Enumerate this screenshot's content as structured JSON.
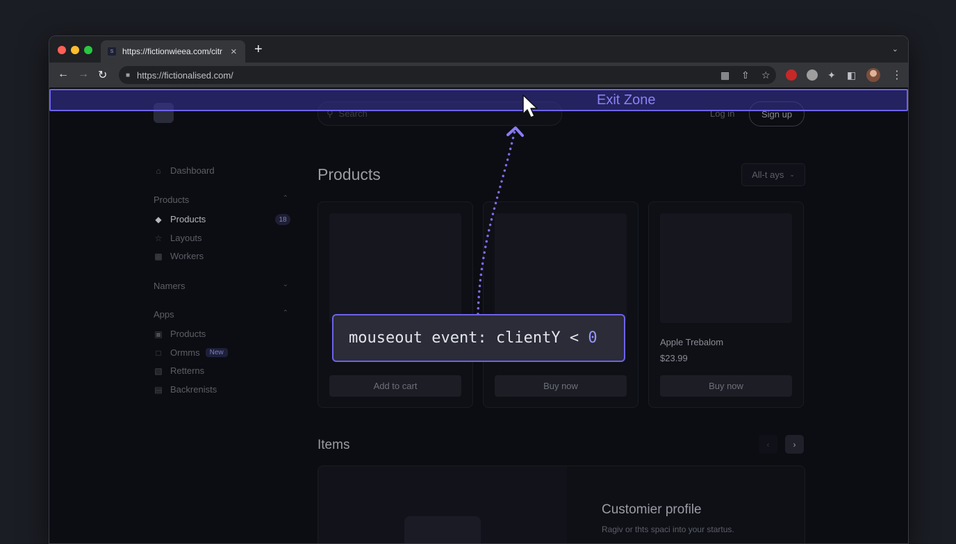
{
  "browser": {
    "tab_title": "https://fictionwieea.com/citr",
    "favicon_text": "S",
    "url": "https://fictionalised.com/",
    "new_tab": "+",
    "close": "×"
  },
  "site": {
    "search_placeholder": "Search",
    "login": "Log in",
    "signup": "Sign up"
  },
  "sidebar": {
    "dashboard": "Dashboard",
    "groups": [
      {
        "label": "Products",
        "expanded": true
      },
      {
        "label": "Namers",
        "expanded": false
      },
      {
        "label": "Apps",
        "expanded": true
      }
    ],
    "products_items": [
      {
        "label": "Products",
        "icon": "tag-icon",
        "active": true,
        "count": "18"
      },
      {
        "label": "Layouts",
        "icon": "star-icon"
      },
      {
        "label": "Workers",
        "icon": "bar-chart-icon"
      }
    ],
    "apps_items": [
      {
        "label": "Products",
        "icon": "image-icon"
      },
      {
        "label": "Ormms",
        "icon": "video-icon",
        "badge": "New"
      },
      {
        "label": "Retterns",
        "icon": "refresh-icon"
      },
      {
        "label": "Backrenists",
        "icon": "document-icon"
      }
    ]
  },
  "main": {
    "products_title": "Products",
    "filter_label": "All-t ays",
    "products": [
      {
        "title": "",
        "price": "",
        "button": "Add to cart"
      },
      {
        "title": "",
        "price": "",
        "button": "Buy now"
      },
      {
        "title": "Apple Trebalom",
        "price": "$23.99",
        "button": "Buy now"
      }
    ],
    "items_title": "Items",
    "panel_title": "Customier profile",
    "panel_subtitle": "Ragiv or thts spaci into your startus."
  },
  "overlay": {
    "exit_zone_label": "Exit Zone",
    "code_prefix": "mouseout event: clientY < ",
    "code_value": "0",
    "accent": "#6d63e8"
  }
}
